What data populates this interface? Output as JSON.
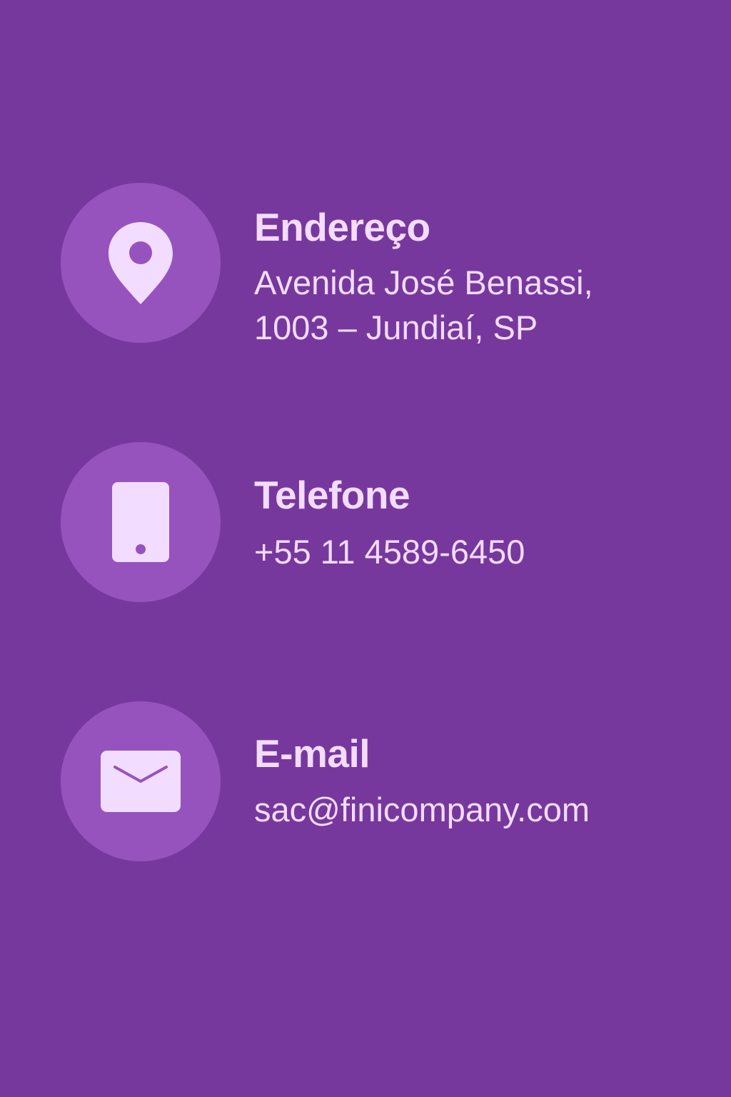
{
  "colors": {
    "background": "#77389d",
    "icon_circle": "#9653be",
    "foreground": "#f2dcff"
  },
  "contacts": [
    {
      "icon": "map-pin-icon",
      "label": "Endereço",
      "value_line1": "Avenida José Benassi,",
      "value_line2": "1003 – Jundiaí, SP"
    },
    {
      "icon": "smartphone-icon",
      "label": "Telefone",
      "value": "+55 11 4589-6450"
    },
    {
      "icon": "envelope-icon",
      "label": "E-mail",
      "value": "sac@finicompany.com"
    }
  ]
}
